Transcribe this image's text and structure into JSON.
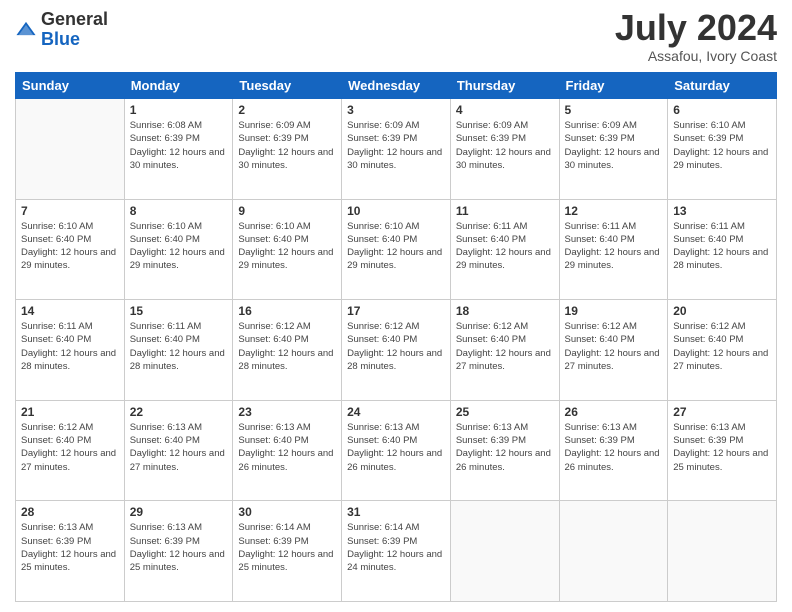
{
  "header": {
    "logo": {
      "general": "General",
      "blue": "Blue"
    },
    "title": "July 2024",
    "location": "Assafou, Ivory Coast"
  },
  "days_of_week": [
    "Sunday",
    "Monday",
    "Tuesday",
    "Wednesday",
    "Thursday",
    "Friday",
    "Saturday"
  ],
  "weeks": [
    [
      {
        "day": "",
        "info": ""
      },
      {
        "day": "1",
        "info": "Sunrise: 6:08 AM\nSunset: 6:39 PM\nDaylight: 12 hours and 30 minutes."
      },
      {
        "day": "2",
        "info": "Sunrise: 6:09 AM\nSunset: 6:39 PM\nDaylight: 12 hours and 30 minutes."
      },
      {
        "day": "3",
        "info": "Sunrise: 6:09 AM\nSunset: 6:39 PM\nDaylight: 12 hours and 30 minutes."
      },
      {
        "day": "4",
        "info": "Sunrise: 6:09 AM\nSunset: 6:39 PM\nDaylight: 12 hours and 30 minutes."
      },
      {
        "day": "5",
        "info": "Sunrise: 6:09 AM\nSunset: 6:39 PM\nDaylight: 12 hours and 30 minutes."
      },
      {
        "day": "6",
        "info": "Sunrise: 6:10 AM\nSunset: 6:39 PM\nDaylight: 12 hours and 29 minutes."
      }
    ],
    [
      {
        "day": "7",
        "info": ""
      },
      {
        "day": "8",
        "info": "Sunrise: 6:10 AM\nSunset: 6:40 PM\nDaylight: 12 hours and 29 minutes."
      },
      {
        "day": "9",
        "info": "Sunrise: 6:10 AM\nSunset: 6:40 PM\nDaylight: 12 hours and 29 minutes."
      },
      {
        "day": "10",
        "info": "Sunrise: 6:10 AM\nSunset: 6:40 PM\nDaylight: 12 hours and 29 minutes."
      },
      {
        "day": "11",
        "info": "Sunrise: 6:11 AM\nSunset: 6:40 PM\nDaylight: 12 hours and 29 minutes."
      },
      {
        "day": "12",
        "info": "Sunrise: 6:11 AM\nSunset: 6:40 PM\nDaylight: 12 hours and 29 minutes."
      },
      {
        "day": "13",
        "info": "Sunrise: 6:11 AM\nSunset: 6:40 PM\nDaylight: 12 hours and 28 minutes."
      }
    ],
    [
      {
        "day": "14",
        "info": ""
      },
      {
        "day": "15",
        "info": "Sunrise: 6:11 AM\nSunset: 6:40 PM\nDaylight: 12 hours and 28 minutes."
      },
      {
        "day": "16",
        "info": "Sunrise: 6:12 AM\nSunset: 6:40 PM\nDaylight: 12 hours and 28 minutes."
      },
      {
        "day": "17",
        "info": "Sunrise: 6:12 AM\nSunset: 6:40 PM\nDaylight: 12 hours and 28 minutes."
      },
      {
        "day": "18",
        "info": "Sunrise: 6:12 AM\nSunset: 6:40 PM\nDaylight: 12 hours and 27 minutes."
      },
      {
        "day": "19",
        "info": "Sunrise: 6:12 AM\nSunset: 6:40 PM\nDaylight: 12 hours and 27 minutes."
      },
      {
        "day": "20",
        "info": "Sunrise: 6:12 AM\nSunset: 6:40 PM\nDaylight: 12 hours and 27 minutes."
      }
    ],
    [
      {
        "day": "21",
        "info": ""
      },
      {
        "day": "22",
        "info": "Sunrise: 6:13 AM\nSunset: 6:40 PM\nDaylight: 12 hours and 27 minutes."
      },
      {
        "day": "23",
        "info": "Sunrise: 6:13 AM\nSunset: 6:40 PM\nDaylight: 12 hours and 26 minutes."
      },
      {
        "day": "24",
        "info": "Sunrise: 6:13 AM\nSunset: 6:40 PM\nDaylight: 12 hours and 26 minutes."
      },
      {
        "day": "25",
        "info": "Sunrise: 6:13 AM\nSunset: 6:39 PM\nDaylight: 12 hours and 26 minutes."
      },
      {
        "day": "26",
        "info": "Sunrise: 6:13 AM\nSunset: 6:39 PM\nDaylight: 12 hours and 26 minutes."
      },
      {
        "day": "27",
        "info": "Sunrise: 6:13 AM\nSunset: 6:39 PM\nDaylight: 12 hours and 25 minutes."
      }
    ],
    [
      {
        "day": "28",
        "info": "Sunrise: 6:13 AM\nSunset: 6:39 PM\nDaylight: 12 hours and 25 minutes."
      },
      {
        "day": "29",
        "info": "Sunrise: 6:13 AM\nSunset: 6:39 PM\nDaylight: 12 hours and 25 minutes."
      },
      {
        "day": "30",
        "info": "Sunrise: 6:14 AM\nSunset: 6:39 PM\nDaylight: 12 hours and 25 minutes."
      },
      {
        "day": "31",
        "info": "Sunrise: 6:14 AM\nSunset: 6:39 PM\nDaylight: 12 hours and 24 minutes."
      },
      {
        "day": "",
        "info": ""
      },
      {
        "day": "",
        "info": ""
      },
      {
        "day": "",
        "info": ""
      }
    ]
  ],
  "week_7_sun_info": "Sunrise: 6:10 AM\nSunset: 6:40 PM\nDaylight: 12 hours and 29 minutes.",
  "week_14_sun_info": "Sunrise: 6:11 AM\nSunset: 6:40 PM\nDaylight: 12 hours and 28 minutes.",
  "week_21_sun_info": "Sunrise: 6:12 AM\nSunset: 6:40 PM\nDaylight: 12 hours and 27 minutes."
}
